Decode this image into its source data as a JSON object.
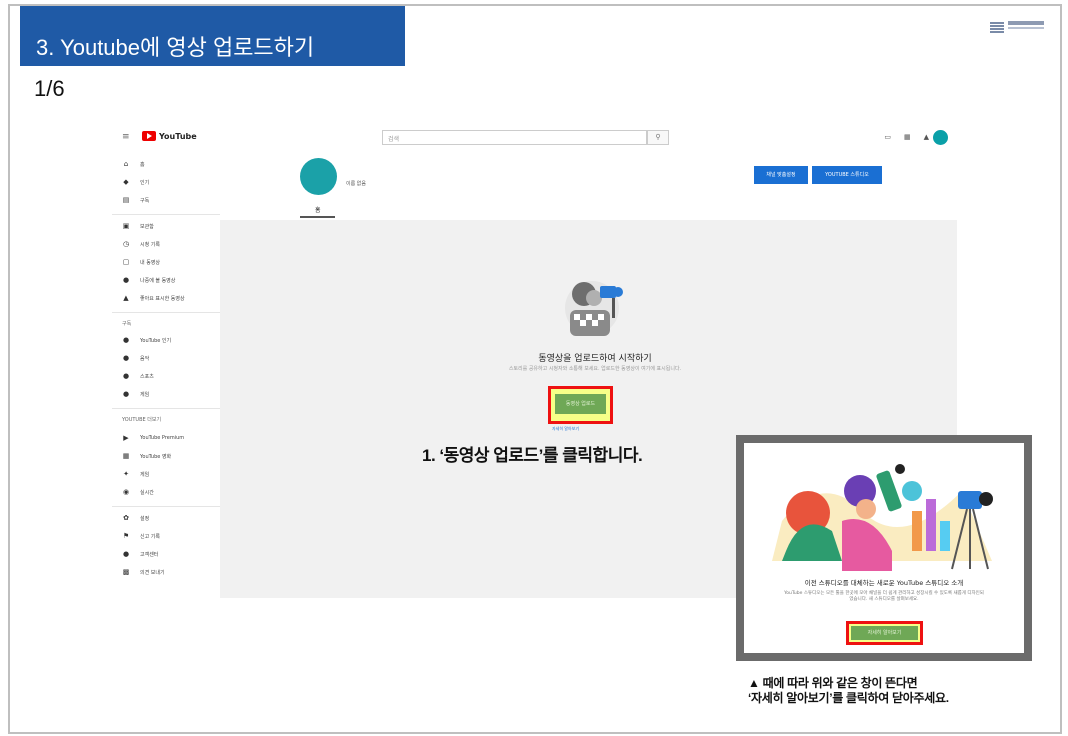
{
  "slide": {
    "title": "3. Youtube에 영상 업로드하기",
    "step": "1/6",
    "instruction": "1.  ‘동영상 업로드’를 클릭합니다.",
    "note_line1": "▲ 때에 따라 위와 같은 창이 뜬다면",
    "note_line2": "‘자세히 알아보기’를 클릭하여 닫아주세요.",
    "highlight_color": "#e11111",
    "title_bar_color": "#1f5aa6"
  },
  "youtube": {
    "logo_text": "YouTube",
    "search_placeholder": "검색",
    "channel_name": "이름 없음",
    "channel_tab": "홈",
    "customize_button": "채널 맞춤설정",
    "studio_button": "YOUTUBE 스튜디오",
    "empty_title": "동영상을 업로드하여 시작하기",
    "empty_desc": "스토리를 공유하고 시청자와 소통해 보세요. 업로드한 동영상이 여기에 표시됩니다.",
    "upload_button": "동영상 업로드",
    "help_link": "자세히 알아보기",
    "avatar_color": "#0aa0a8",
    "sidebar": {
      "main": [
        {
          "icon": "home-icon",
          "glyph": "⌂",
          "label": "홈"
        },
        {
          "icon": "explore-icon",
          "glyph": "◆",
          "label": "인기"
        },
        {
          "icon": "subscriptions-icon",
          "glyph": "▤",
          "label": "구독"
        }
      ],
      "library": [
        {
          "icon": "library-icon",
          "glyph": "▣",
          "label": "보관함"
        },
        {
          "icon": "history-icon",
          "glyph": "◷",
          "label": "시청 기록"
        },
        {
          "icon": "your-videos-icon",
          "glyph": "▢",
          "label": "내 동영상"
        },
        {
          "icon": "watch-later-icon",
          "glyph": "●",
          "label": "나중에 볼 동영상"
        },
        {
          "icon": "liked-icon",
          "glyph": "▲",
          "label": "좋아요 표시한 동영상"
        }
      ],
      "subs_header": "구독",
      "subs": [
        {
          "icon": "channel-icon",
          "glyph": "●",
          "label": "YouTube 인기"
        },
        {
          "icon": "music-icon",
          "glyph": "●",
          "label": "음악"
        },
        {
          "icon": "sports-icon",
          "glyph": "●",
          "label": "스포츠"
        },
        {
          "icon": "gaming-icon",
          "glyph": "●",
          "label": "게임"
        }
      ],
      "more_header": "YOUTUBE 더보기",
      "more": [
        {
          "icon": "premium-icon",
          "glyph": "▶",
          "label": "YouTube Premium"
        },
        {
          "icon": "movies-icon",
          "glyph": "▦",
          "label": "YouTube 영화"
        },
        {
          "icon": "gaming2-icon",
          "glyph": "✦",
          "label": "게임"
        },
        {
          "icon": "live-icon",
          "glyph": "◉",
          "label": "실시간"
        }
      ],
      "settings": [
        {
          "icon": "settings-icon",
          "glyph": "✿",
          "label": "설정"
        },
        {
          "icon": "flag-icon",
          "glyph": "⚑",
          "label": "신고 기록"
        },
        {
          "icon": "help-icon",
          "glyph": "●",
          "label": "고객센터"
        },
        {
          "icon": "feedback-icon",
          "glyph": "▩",
          "label": "의견 보내기"
        }
      ]
    }
  },
  "popup": {
    "title": "이전 스튜디오를 대체하는 새로운 YouTube 스튜디오 소개",
    "desc": "YouTube 스튜디오는 모든 툴을 한곳에 모아 채널을 더 쉽게 관리하고 성장시킬 수 있도록 새롭게 디자인되었습니다. 새 스튜디오를 살펴보세요.",
    "button": "자세히 알아보기"
  },
  "icons": {
    "menu": "menu-icon",
    "search": "search-icon",
    "create": "create-video-icon",
    "apps": "apps-icon",
    "bell": "bell-icon"
  }
}
